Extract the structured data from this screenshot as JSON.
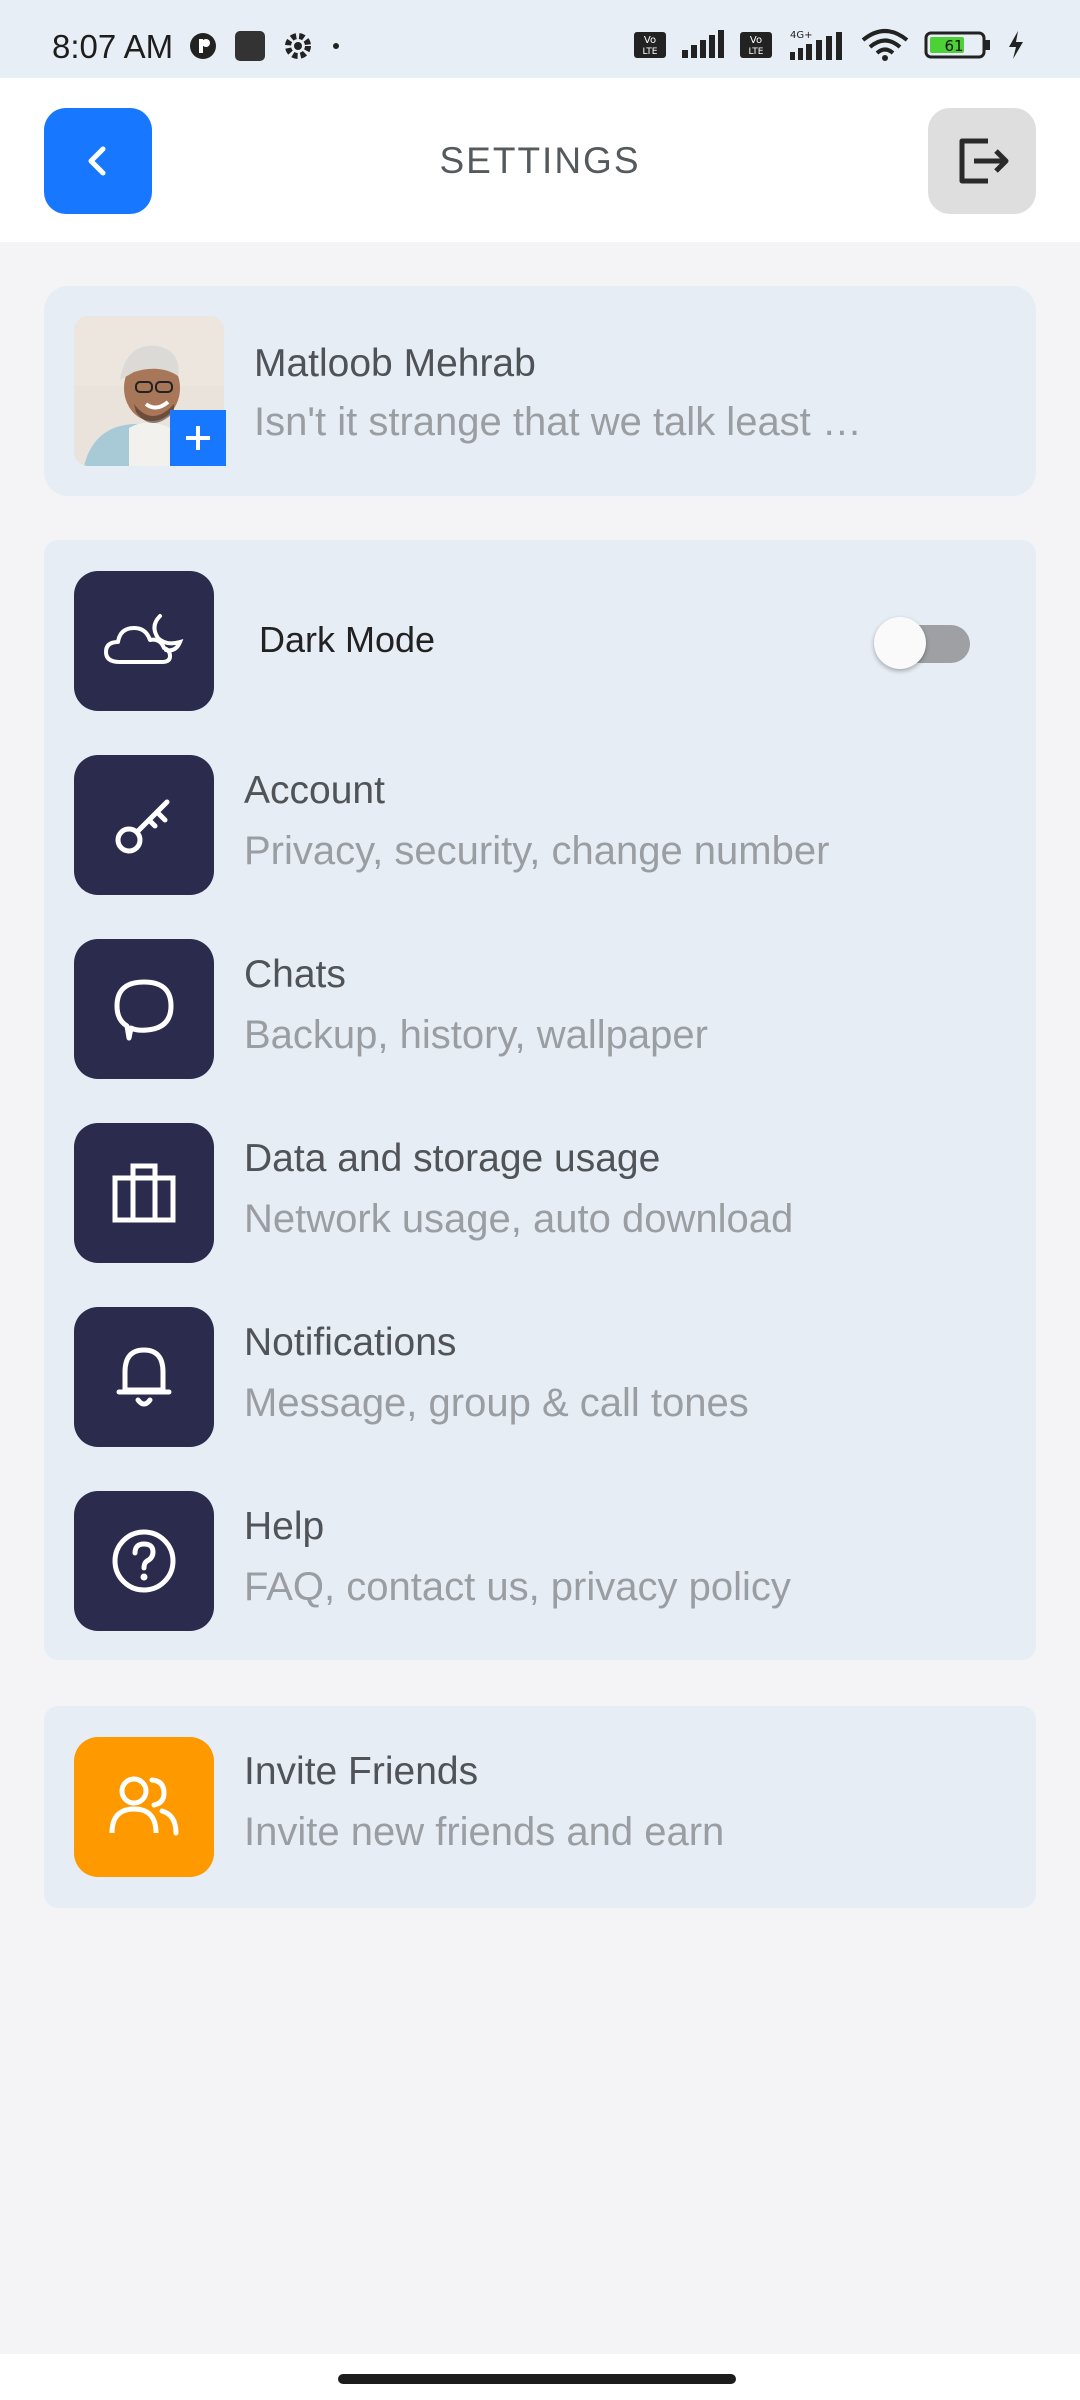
{
  "status": {
    "time": "8:07 AM",
    "battery": "61"
  },
  "header": {
    "title": "SETTINGS"
  },
  "profile": {
    "name": "Matloob Mehrab",
    "status": "Isn't it strange that we talk least …"
  },
  "dark_mode": {
    "label": "Dark Mode",
    "enabled": false
  },
  "settings": [
    {
      "icon": "key-icon",
      "title": "Account",
      "subtitle": "Privacy, security, change number"
    },
    {
      "icon": "chat-bubble-icon",
      "title": "Chats",
      "subtitle": "Backup, history, wallpaper"
    },
    {
      "icon": "briefcase-icon",
      "title": "Data and storage usage",
      "subtitle": "Network usage, auto download"
    },
    {
      "icon": "bell-icon",
      "title": "Notifications",
      "subtitle": "Message, group & call tones"
    },
    {
      "icon": "help-icon",
      "title": "Help",
      "subtitle": "FAQ, contact us, privacy policy"
    }
  ],
  "invite": {
    "icon": "users-icon",
    "title": "Invite Friends",
    "subtitle": "Invite new friends and earn"
  },
  "colors": {
    "primary_blue": "#1877ff",
    "icon_navy": "#2b2b4d",
    "invite_orange": "#ff9900",
    "card_bg": "#e6edf5"
  }
}
